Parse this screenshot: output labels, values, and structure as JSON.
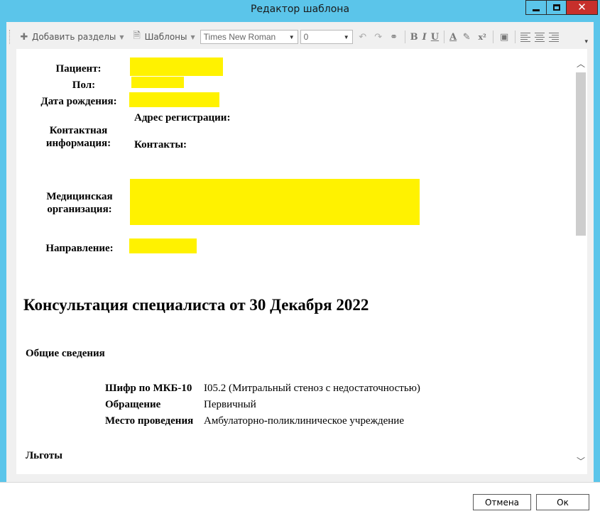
{
  "window": {
    "title": "Редактор шаблона"
  },
  "toolbar": {
    "add_sections": "Добавить разделы",
    "templates": "Шаблоны",
    "font_family": "Times New Roman",
    "font_size": "0",
    "bold": "B",
    "italic": "I",
    "underline": "U",
    "font_color": "A",
    "superscript": "x²"
  },
  "document": {
    "labels": {
      "patient": "Пациент:",
      "sex": "Пол:",
      "birth_date": "Дата рождения:",
      "reg_address": "Адрес регистрации:",
      "contact_info": "Контактная информация:",
      "contacts": "Контакты:",
      "med_org": "Медицинская организация:",
      "referral": "Направление:"
    },
    "heading": "Консультация специалиста от 30 Декабря 2022",
    "general_section": "Общие сведения",
    "fields": [
      {
        "key": "Шифр по МКБ-10",
        "value": "I05.2 (Митральный стеноз с недостаточностью)"
      },
      {
        "key": "Обращение",
        "value": "Первичный"
      },
      {
        "key": "Место проведения",
        "value": "Амбулаторно-поликлиническое учреждение"
      }
    ],
    "benefits_section": "Льготы"
  },
  "buttons": {
    "cancel": "Отмена",
    "ok": "Ок"
  },
  "colors": {
    "titlebar": "#5bc5ea",
    "highlight": "#fff200",
    "close": "#c7302b"
  }
}
